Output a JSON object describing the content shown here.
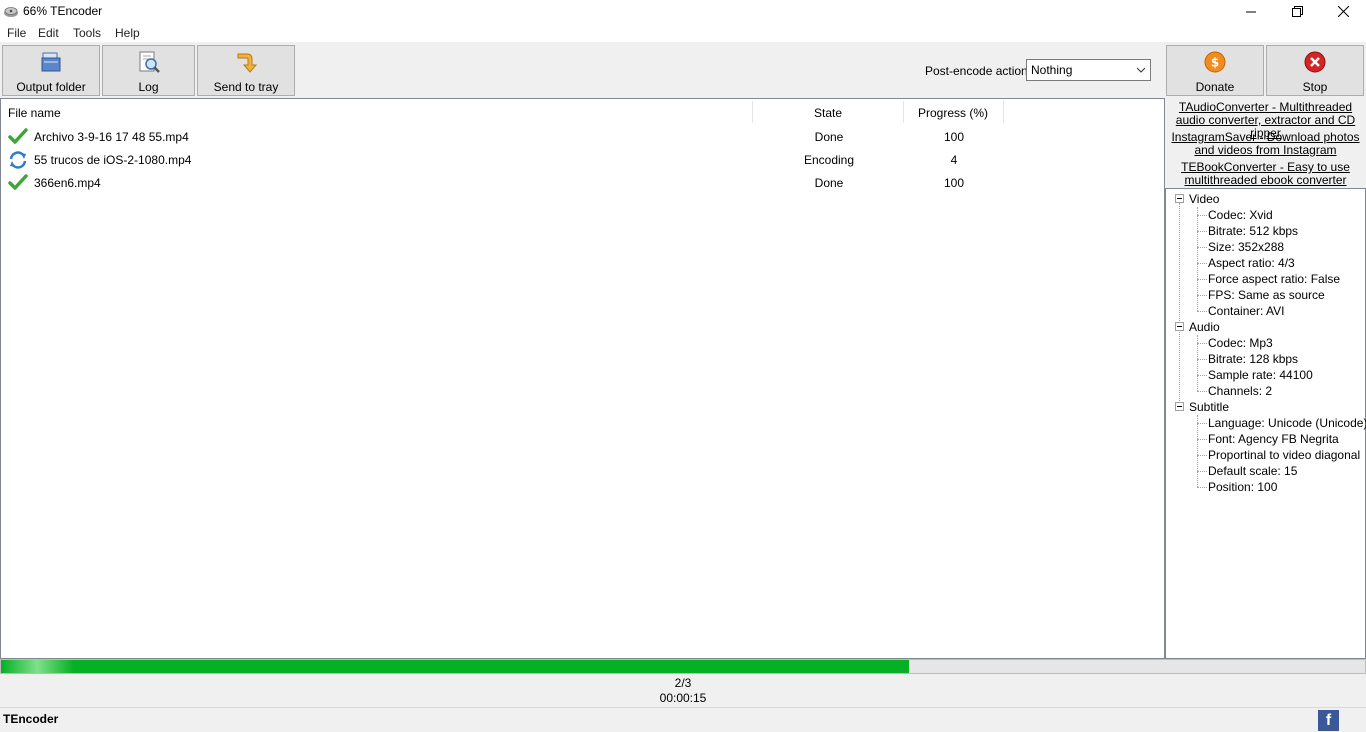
{
  "window": {
    "title": "66% TEncoder"
  },
  "menu": [
    "File",
    "Edit",
    "Tools",
    "Help"
  ],
  "toolbar": {
    "output_folder": "Output folder",
    "log": "Log",
    "send_to_tray": "Send to tray",
    "post_action_label": "Post-encode action:",
    "post_action_value": "Nothing",
    "donate": "Donate",
    "stop": "Stop"
  },
  "list": {
    "headers": {
      "file": "File name",
      "state": "State",
      "progress": "Progress (%)"
    },
    "rows": [
      {
        "file": "Archivo 3-9-16 17 48 55.mp4",
        "state": "Done",
        "progress": "100",
        "icon": "check-icon"
      },
      {
        "file": "55 trucos de iOS-2-1080.mp4",
        "state": "Encoding",
        "progress": "4",
        "icon": "refresh-icon"
      },
      {
        "file": "366en6.mp4",
        "state": "Done",
        "progress": "100",
        "icon": "check-icon"
      }
    ]
  },
  "links": [
    "TAudioConverter - Multithreaded audio converter, extractor and CD ripper",
    "InstagramSaver - Download photos and videos from Instagram",
    "TEBookConverter - Easy to use multithreaded ebook converter"
  ],
  "tree": {
    "video": {
      "label": "Video",
      "items": [
        "Codec: Xvid",
        "Bitrate: 512 kbps",
        "Size: 352x288",
        "Aspect ratio: 4/3",
        "Force aspect ratio: False",
        "FPS: Same as source",
        "Container: AVI"
      ]
    },
    "audio": {
      "label": "Audio",
      "items": [
        "Codec: Mp3",
        "Bitrate: 128 kbps",
        "Sample rate: 44100",
        "Channels: 2"
      ]
    },
    "subtitle": {
      "label": "Subtitle",
      "items": [
        "Language: Unicode (Unicode)",
        "Font: Agency FB Negrita",
        "Proportinal to video diagonal",
        "Default scale: 15",
        "Position: 100"
      ]
    }
  },
  "progress": {
    "fraction": 0.666,
    "count": "2/3",
    "elapsed": "00:00:15"
  },
  "status": {
    "text": "TEncoder",
    "facebook": "f"
  },
  "colors": {
    "progress": "#06b025",
    "facebook": "#3b5998"
  }
}
